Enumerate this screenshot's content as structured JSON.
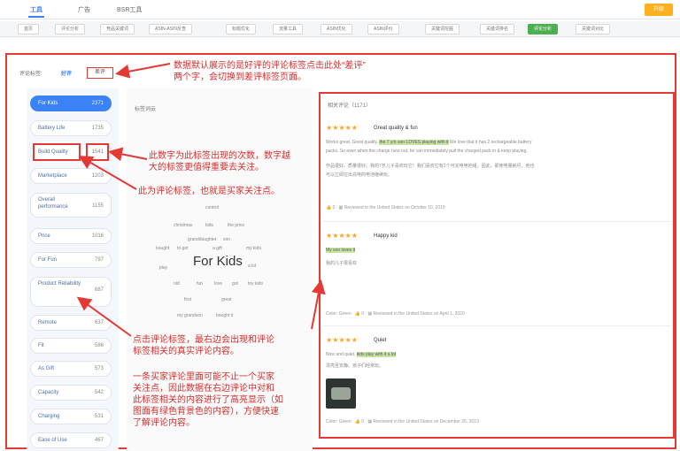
{
  "top_tabs": [
    "工具",
    "广告",
    "BSR工具"
  ],
  "top_button": "升级",
  "nav_items": [
    "首页",
    "评论分析",
    "竞品关键词",
    "ASIN-ASIN反查",
    "标题优化",
    "流量工具",
    "ASIN优化",
    "ASIN评价",
    "关键词挖掘",
    "关键词排名",
    "评论分析",
    "关键词对比"
  ],
  "nav_active_index": 9,
  "filter": {
    "label": "评论标签:",
    "positive": "好评",
    "negative": "差评"
  },
  "tags": [
    {
      "label": "For Kids",
      "count": "2371",
      "active": true
    },
    {
      "label": "Battery Life",
      "count": "1735"
    },
    {
      "label": "Build Quality",
      "count": "1541"
    },
    {
      "label": "Marketplace",
      "count": "1203"
    },
    {
      "label": "Overall performance",
      "count": "1155"
    },
    {
      "label": "Price",
      "count": "1016"
    },
    {
      "label": "For Fun",
      "count": "797"
    },
    {
      "label": "Product Reliability",
      "count": "687"
    },
    {
      "label": "Remote",
      "count": "637"
    },
    {
      "label": "Fit",
      "count": "586"
    },
    {
      "label": "As Gift",
      "count": "573"
    },
    {
      "label": "Capacity",
      "count": "542"
    },
    {
      "label": "Charging",
      "count": "531"
    },
    {
      "label": "Ease of Use",
      "count": "467"
    }
  ],
  "cloud": {
    "title": "标签词云",
    "center_word": "For Kids",
    "words": [
      "control",
      "christmas",
      "kids",
      "the price",
      "granddaughter",
      "son",
      "bought",
      "to get",
      "a gift",
      "my kids",
      "play",
      "a lot",
      "old",
      "fun",
      "love",
      "got",
      "toy kids",
      "first",
      "great",
      "my grandson",
      "bought it"
    ]
  },
  "reviews_title": "相关评论（1171）",
  "reviews": [
    {
      "stars": "★★★★★",
      "title": "Great quality & fun",
      "lines": [
        "Works great. Great quality.",
        "the 7 y/o son LOVES playing with it",
        "We love that it has 2 rechargeable battery",
        "packs. So even when the charge runs out, he can immediately pull the charged pack in & keep playing.",
        "作品很好。质量很好。我的7岁儿子喜欢玩它！我们喜欢它有2个可充电电池组，因此，即使电量耗尽，他也",
        "可以立即拉出充电的电池继续玩。"
      ],
      "votes": "0",
      "meta": "Reviewed in the United States on October 10, 2019"
    },
    {
      "stars": "★★★★★",
      "title": "Happy kid",
      "lines": [
        "My son loves it",
        "我的儿子很喜欢"
      ],
      "votes": "0",
      "color": "Color: Green",
      "meta": "Reviewed in the United States on April 1, 2020"
    },
    {
      "stars": "★★★★★",
      "title": "Quiet",
      "lines": [
        "Nice and quiet.",
        "kids play with it a lot",
        "漂亮且安静。孩子们经常玩。"
      ],
      "votes": "0",
      "color": "Color: Green",
      "meta": "Reviewed in the United States on December 26, 2019"
    }
  ],
  "annotations": {
    "a1": "数据默认展示的是好评的评论标签点击此处“差评”",
    "a1b": "两个字，会切换到差评标签页面。",
    "a2": "此数字为此标签出现的次数，数字越",
    "a2b": "大的标签更值得重要去关注。",
    "a3": "此为评论标签，也就是买家关注点。",
    "a4": "点击评论标签，最右边会出现和评论",
    "a4b": "标签相关的真实评论内容。",
    "a5": "一条买家评论里面可能不止一个买家",
    "a5b": "关注点，因此数据在右边评论中对和",
    "a5c": "此标签相关的内容进行了高亮显示（如",
    "a5d": "图面有绿色背景色的内容），方便快速",
    "a5e": "了解评论内容。"
  },
  "colors": {
    "accent": "#3b82f6",
    "annotation": "#e53935",
    "highlight": "#c8e6a0",
    "star": "#ffa41c"
  }
}
